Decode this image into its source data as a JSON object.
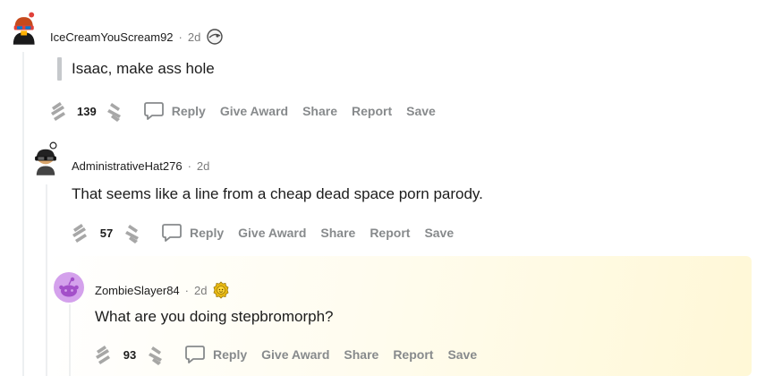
{
  "comments": [
    {
      "username": "IceCreamYouScream92",
      "separator": "·",
      "time": "2d",
      "body": "Isaac, make ass hole",
      "score": "139",
      "actions": {
        "reply": "Reply",
        "give_award": "Give Award",
        "share": "Share",
        "report": "Report",
        "save": "Save"
      }
    },
    {
      "username": "AdministrativeHat276",
      "separator": "·",
      "time": "2d",
      "body": "That seems like a line from a cheap dead space porn parody.",
      "score": "57",
      "actions": {
        "reply": "Reply",
        "give_award": "Give Award",
        "share": "Share",
        "report": "Report",
        "save": "Save"
      }
    },
    {
      "username": "ZombieSlayer84",
      "separator": "·",
      "time": "2d",
      "body": "What are you doing stepbromorph?",
      "score": "93",
      "actions": {
        "reply": "Reply",
        "give_award": "Give Award",
        "share": "Share",
        "report": "Report",
        "save": "Save"
      }
    }
  ],
  "colors": {
    "meta": "#7c7c7c",
    "action": "#878a8c",
    "highlight": "#fff7d2"
  }
}
